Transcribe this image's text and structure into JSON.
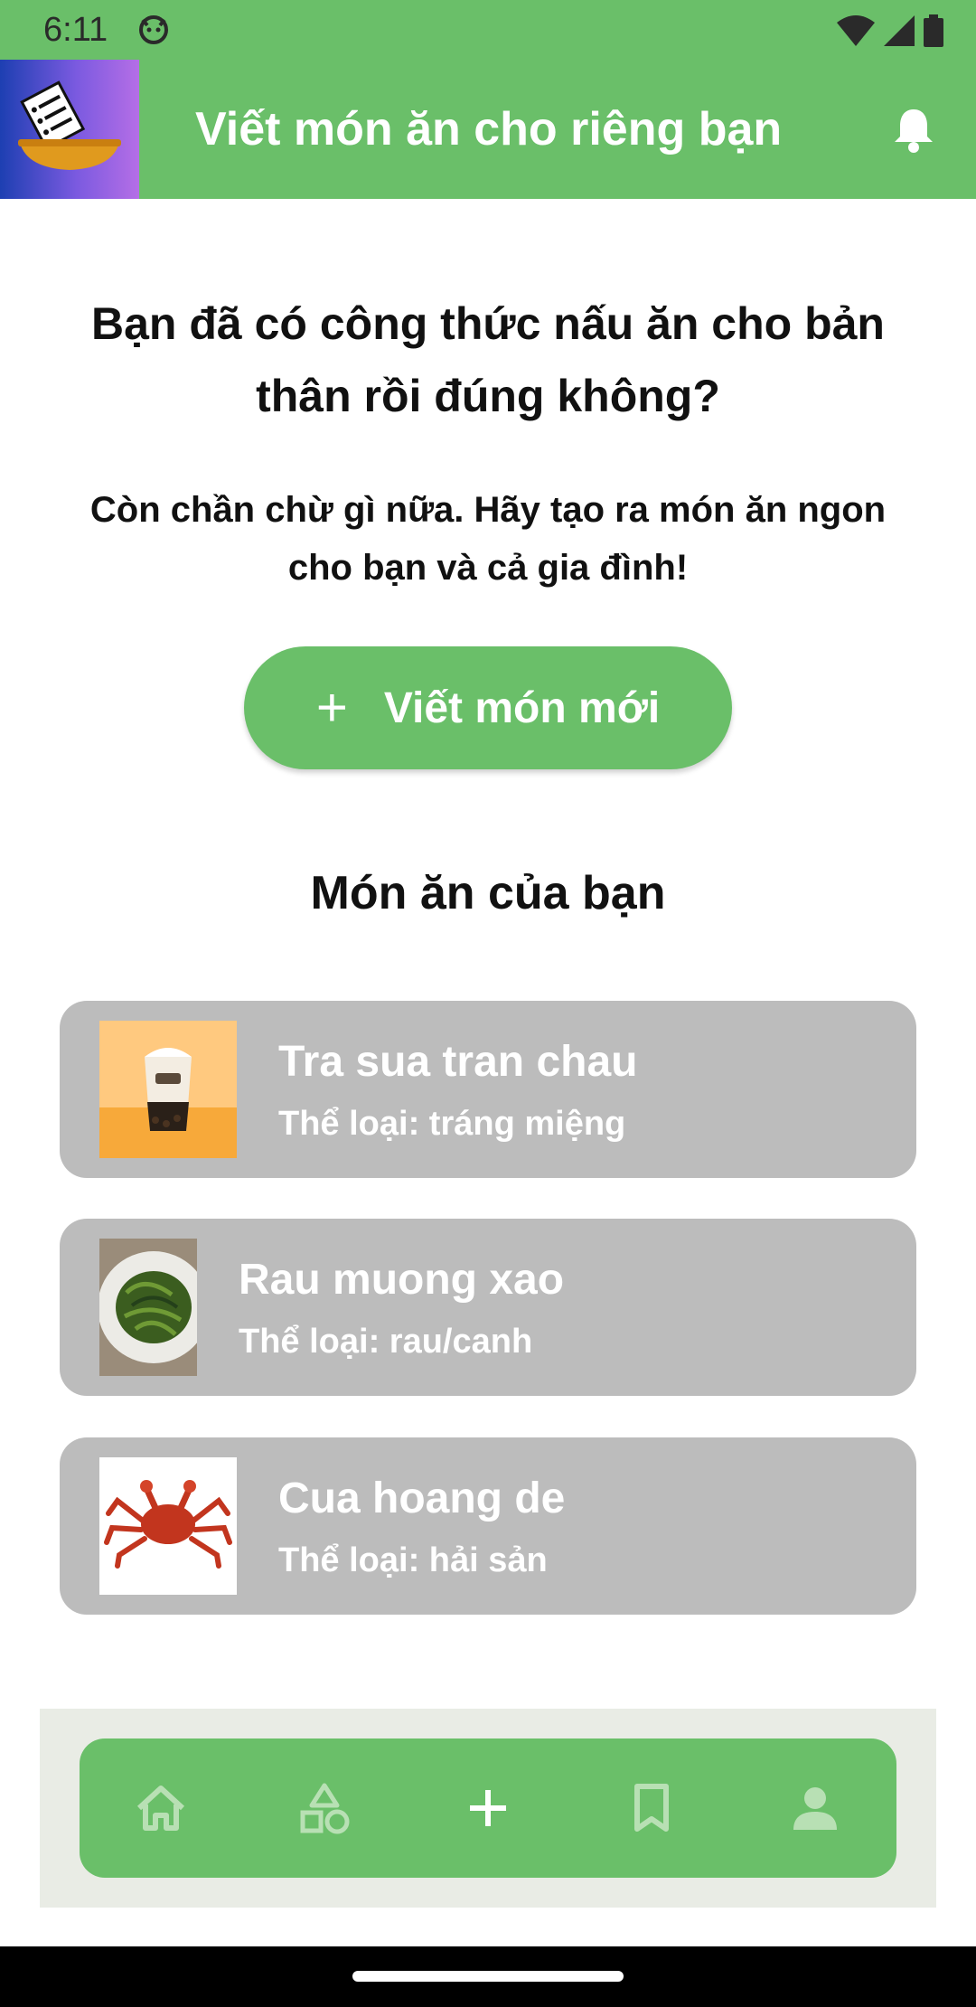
{
  "status_bar": {
    "time": "6:11"
  },
  "app_bar": {
    "title": "Viết món ăn cho riêng bạn",
    "notification_icon": "bell-icon",
    "background": "#6abf69"
  },
  "main": {
    "heading": "Bạn đã có công thức nấu ăn cho bản thân rồi đúng không?",
    "subtext": "Còn chần chừ gì nữa. Hãy tạo ra món ăn ngon cho bạn và cả gia đình!",
    "new_button_icon": "+",
    "new_button_label": "Viết món mới",
    "section_title": "Món ăn của bạn"
  },
  "recipes": [
    {
      "name": "Tra sua tran chau",
      "category": "Thể loại: tráng miệng"
    },
    {
      "name": "Rau muong xao",
      "category": "Thể loại: rau/canh"
    },
    {
      "name": "Cua hoang de",
      "category": "Thể loại: hải sản"
    }
  ],
  "bottom_nav": {
    "items": [
      "home-icon",
      "categories-icon",
      "add-icon",
      "bookmark-icon",
      "profile-icon"
    ],
    "active": "add-icon"
  },
  "colors": {
    "primary_green": "#6abf69",
    "card_gray": "#bcbcbc",
    "nav_background": "#e9ece5"
  }
}
